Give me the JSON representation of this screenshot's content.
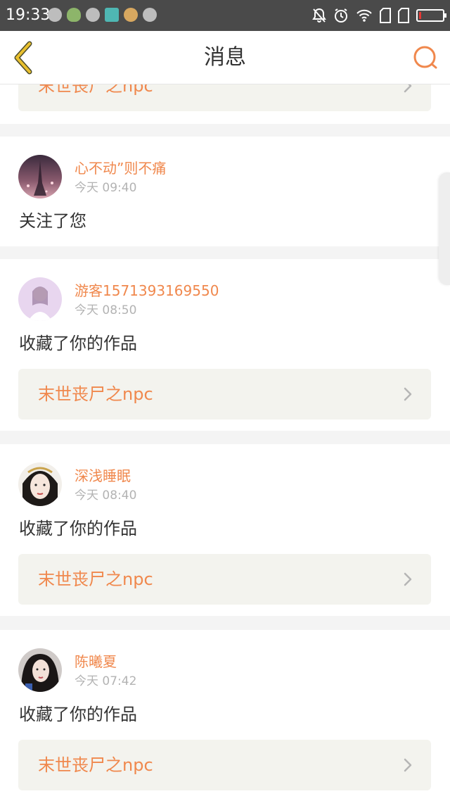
{
  "status_bar": {
    "time": "19:33",
    "notification_icons": [
      "app-icon",
      "leaf-icon",
      "app-icon",
      "scan-icon",
      "face-icon",
      "app-icon"
    ],
    "right_icons": [
      "mute-bell-icon",
      "alarm-icon",
      "wifi-icon",
      "sim-icon",
      "sim-icon",
      "battery-icon"
    ],
    "battery_level": 0.1,
    "battery_color": "#e53935"
  },
  "header": {
    "title": "消息",
    "back_icon": "chevron-left-icon",
    "search_icon": "search-icon",
    "accent_color": "#f0884d",
    "back_color": "#e9c02f"
  },
  "top_partial_card": {
    "work_title": "末世丧尸之npc"
  },
  "messages": [
    {
      "username": "心不动”则不痛",
      "time": "今天 09:40",
      "action": "关注了您"
    },
    {
      "username": "游客1571393169550",
      "time": "今天 08:50",
      "action": "收藏了你的作品",
      "work_title": "末世丧尸之npc"
    },
    {
      "username": "深浅睡眠",
      "time": "今天 08:40",
      "action": "收藏了你的作品",
      "work_title": "末世丧尸之npc"
    },
    {
      "username": "陈曦夏",
      "time": "今天 07:42",
      "action": "收藏了你的作品",
      "work_title": "末世丧尸之npc"
    }
  ]
}
